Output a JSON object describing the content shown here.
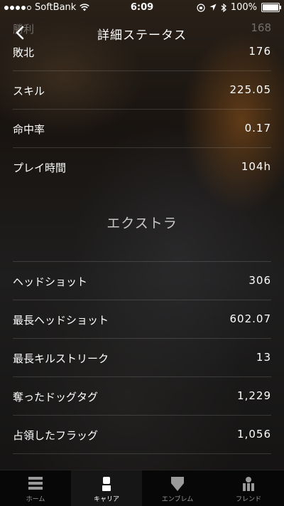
{
  "status_bar": {
    "carrier": "SoftBank",
    "time": "6:09",
    "battery": "100%"
  },
  "header": {
    "title": "詳細ステータス",
    "ghost_label": "勝利",
    "ghost_value": "168"
  },
  "stats": [
    {
      "label": "敗北",
      "value": "176"
    },
    {
      "label": "スキル",
      "value": "225.05"
    },
    {
      "label": "命中率",
      "value": "0.17"
    },
    {
      "label": "プレイ時間",
      "value": "104h"
    }
  ],
  "extra_section": {
    "title": "エクストラ",
    "items": [
      {
        "label": "ヘッドショット",
        "value": "306"
      },
      {
        "label": "最長ヘッドショット",
        "value": "602.07"
      },
      {
        "label": "最長キルストリーク",
        "value": "13"
      },
      {
        "label": "奪ったドッグタグ",
        "value": "1,229"
      },
      {
        "label": "占領したフラッグ",
        "value": "1,056"
      }
    ]
  },
  "tabs": [
    {
      "label": "ホーム",
      "icon": "home-icon"
    },
    {
      "label": "キャリア",
      "icon": "career-icon"
    },
    {
      "label": "エンブレム",
      "icon": "emblem-icon"
    },
    {
      "label": "フレンド",
      "icon": "friends-icon"
    }
  ],
  "active_tab": "キャリア"
}
